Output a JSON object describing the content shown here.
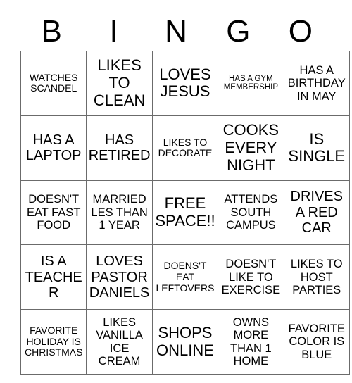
{
  "card": {
    "title_letters": [
      "B",
      "I",
      "N",
      "G",
      "O"
    ],
    "columns": 5,
    "rows": 5,
    "border_color": "#6b6b6b",
    "text_color": "#000000",
    "background_color": "#ffffff"
  },
  "cells": [
    [
      {
        "text": "WATCHES SCANDEL",
        "size": "fs-sm"
      },
      {
        "text": "LIKES TO CLEAN",
        "size": "fs-xl"
      },
      {
        "text": "LOVES JESUS",
        "size": "fs-xl"
      },
      {
        "text": "HAS A GYM MEMBERSHIP",
        "size": "fs-xs"
      },
      {
        "text": "HAS A BIRTHDAY IN MAY",
        "size": "fs-md"
      }
    ],
    [
      {
        "text": "HAS A LAPTOP",
        "size": "fs-lg"
      },
      {
        "text": "HAS RETIRED",
        "size": "fs-lg"
      },
      {
        "text": "LIKES TO DECORATE",
        "size": "fs-sm"
      },
      {
        "text": "COOKS EVERY NIGHT",
        "size": "fs-xl"
      },
      {
        "text": "IS SINGLE",
        "size": "fs-xl"
      }
    ],
    [
      {
        "text": "DOESN'T EAT FAST FOOD",
        "size": "fs-md"
      },
      {
        "text": "MARRIED LES THAN 1 YEAR",
        "size": "fs-md"
      },
      {
        "text": "FREE SPACE!!",
        "size": "fs-xl"
      },
      {
        "text": "ATTENDS SOUTH CAMPUS",
        "size": "fs-md"
      },
      {
        "text": "DRIVES A RED CAR",
        "size": "fs-lg"
      }
    ],
    [
      {
        "text": "IS A TEACHER",
        "size": "fs-lg"
      },
      {
        "text": "LOVES PASTOR DANIELS",
        "size": "fs-lg"
      },
      {
        "text": "DOENS'T EAT LEFTOVERS",
        "size": "fs-sm"
      },
      {
        "text": "DOESN'T LIKE TO EXERCISE",
        "size": "fs-md"
      },
      {
        "text": "LIKES TO HOST PARTIES",
        "size": "fs-md"
      }
    ],
    [
      {
        "text": "FAVORITE HOLIDAY IS CHRISTMAS",
        "size": "fs-sm"
      },
      {
        "text": "LIKES VANILLA ICE CREAM",
        "size": "fs-md"
      },
      {
        "text": "SHOPS ONLINE",
        "size": "fs-xl"
      },
      {
        "text": "OWNS MORE THAN 1 HOME",
        "size": "fs-md"
      },
      {
        "text": "FAVORITE COLOR IS BLUE",
        "size": "fs-md"
      }
    ]
  ]
}
